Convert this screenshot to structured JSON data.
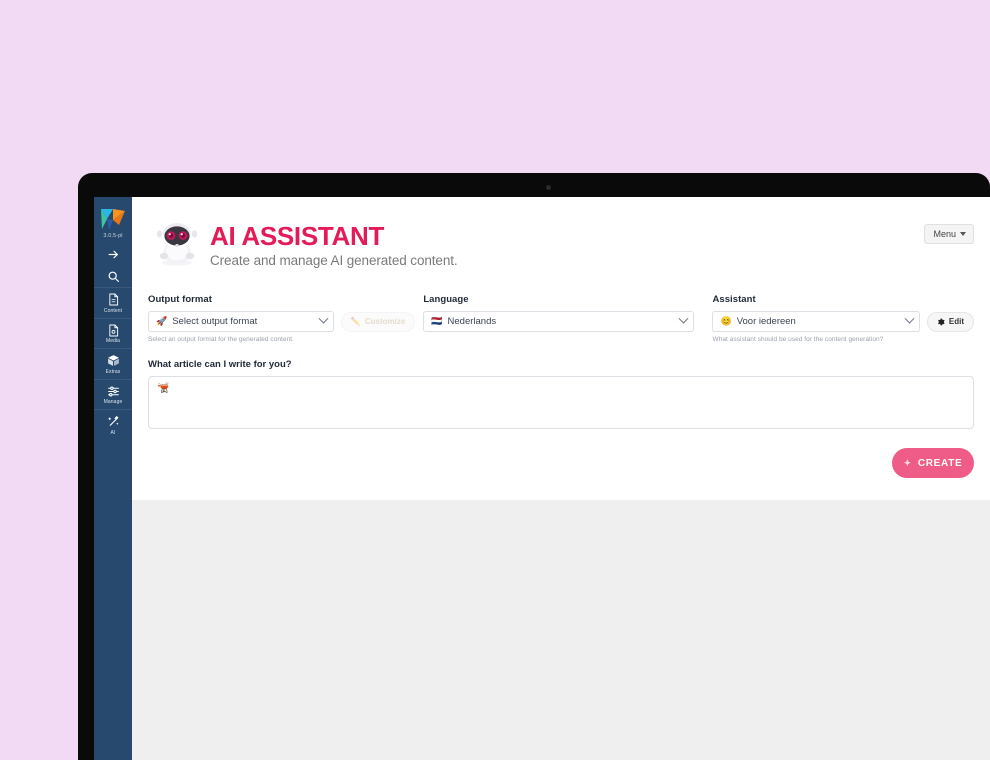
{
  "sidebar": {
    "logo_icon": "brand-logo-icon",
    "version": "3.0.5-pl",
    "items": [
      {
        "icon": "arrow-right-icon",
        "label": ""
      },
      {
        "icon": "search-icon",
        "label": ""
      },
      {
        "icon": "document-icon",
        "label": "Content"
      },
      {
        "icon": "media-file-icon",
        "label": "Media"
      },
      {
        "icon": "box-icon",
        "label": "Extras"
      },
      {
        "icon": "sliders-icon",
        "label": "Manage"
      },
      {
        "icon": "magic-wand-icon",
        "label": "AI"
      }
    ]
  },
  "header": {
    "mascot_icon": "robot-mascot-icon",
    "title": "AI ASSISTANT",
    "subtitle": "Create and manage AI generated content.",
    "title_color": "#e31b58",
    "menu_label": "Menu"
  },
  "form": {
    "output_format": {
      "label": "Output format",
      "emoji": "🚀",
      "value": "Select output format",
      "help": "Select an output format for the generated content.",
      "customize_label": "Customize",
      "customize_emoji": "✏️",
      "customize_disabled": true
    },
    "language": {
      "label": "Language",
      "emoji": "🇳🇱",
      "value": "Nederlands"
    },
    "assistant": {
      "label": "Assistant",
      "emoji": "😊",
      "value": "Voor iedereen",
      "help": "What assistant should be used for the content generation?",
      "edit_label": "Edit",
      "edit_icon": "gear-icon"
    },
    "prompt": {
      "label": "What article can I write for you?",
      "value": "🫕",
      "placeholder": ""
    },
    "create_button": {
      "label": "CREATE",
      "icon": "sparkle-icon",
      "color": "#ef5c87"
    }
  }
}
